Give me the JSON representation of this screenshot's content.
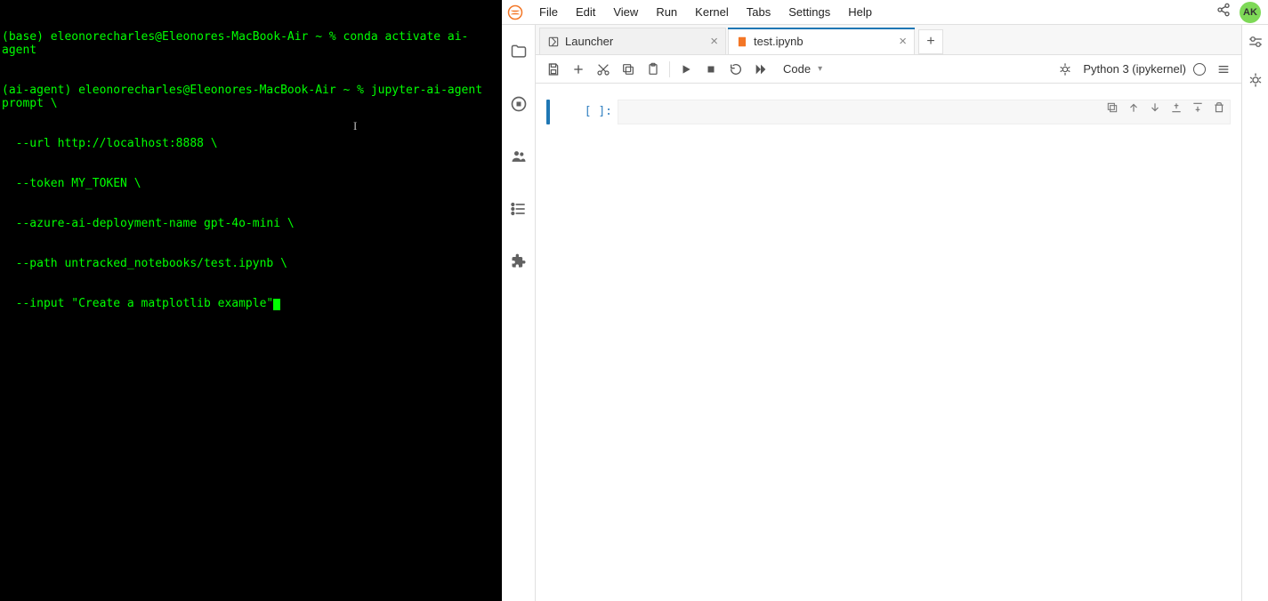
{
  "terminal": {
    "lines": [
      "(base) eleonorecharles@Eleonores-MacBook-Air ~ % conda activate ai-agent",
      "(ai-agent) eleonorecharles@Eleonores-MacBook-Air ~ % jupyter-ai-agent prompt \\",
      "  --url http://localhost:8888 \\",
      "  --token MY_TOKEN \\",
      "  --azure-ai-deployment-name gpt-4o-mini \\",
      "  --path untracked_notebooks/test.ipynb \\",
      "  --input \"Create a matplotlib example\""
    ]
  },
  "menubar": {
    "items": [
      "File",
      "Edit",
      "View",
      "Run",
      "Kernel",
      "Tabs",
      "Settings",
      "Help"
    ],
    "avatar_initials": "AK"
  },
  "tabs": [
    {
      "label": "Launcher",
      "active": false,
      "icon": "launcher"
    },
    {
      "label": "test.ipynb",
      "active": true,
      "icon": "notebook"
    }
  ],
  "toolbar": {
    "cell_type": "Code",
    "kernel_name": "Python 3 (ipykernel)"
  },
  "cell": {
    "prompt": "[ ]:",
    "content": ""
  }
}
